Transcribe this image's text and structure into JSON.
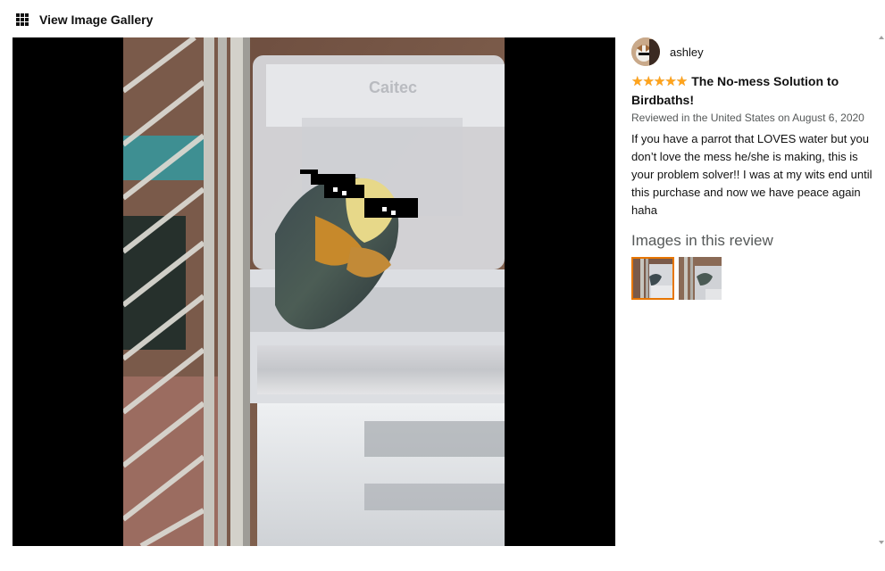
{
  "gallery": {
    "title": "View Image Gallery",
    "icon": "grid-icon"
  },
  "review": {
    "reviewer_name": "ashley",
    "rating": 5,
    "stars_text": "★★★★★",
    "title": "The No-mess Solution to Birdbaths!",
    "meta": "Reviewed in the United States on August 6, 2020",
    "body": "If you have a parrot that LOVES water but you don’t love the mess he/she is making, this is your problem solver!! I was at my wits end until this purchase and now we have peace again haha"
  },
  "images": {
    "heading": "Images in this review",
    "count": 2,
    "selected_index": 0
  },
  "colors": {
    "star": "#ffa41c",
    "selected_border": "#e77600",
    "meta_text": "#565959"
  }
}
